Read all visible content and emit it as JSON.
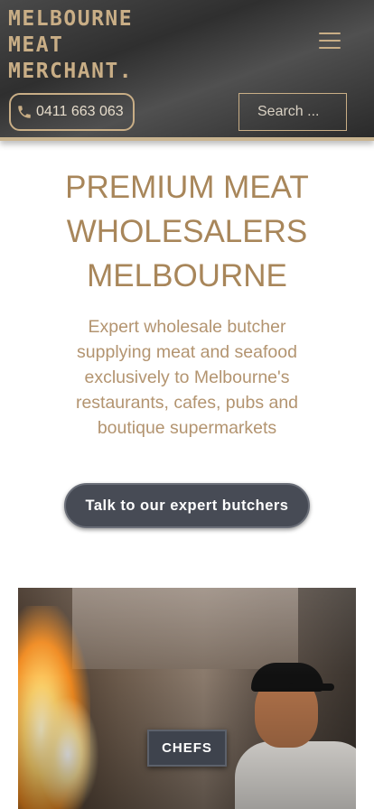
{
  "header": {
    "logo_lines": [
      "MELBOURNE",
      "MEAT",
      "MERCHANT."
    ],
    "phone_label": "0411 663 063",
    "search_placeholder": "Search ...",
    "menu_icon": "hamburger-menu-icon",
    "phone_icon": "phone-icon"
  },
  "hero": {
    "title": "PREMIUM MEAT WHOLESALERS MELBOURNE",
    "subtitle": "Expert wholesale butcher supplying meat and seafood exclusively to Melbourne's restaurants, cafes, pubs and boutique supermarkets",
    "cta_label": "Talk to our expert butchers"
  },
  "cards": [
    {
      "label": "CHEFS"
    }
  ],
  "colors": {
    "accent_gold": "#c9ae86",
    "title_gold": "#a8865a",
    "button_dark": "#474b55"
  }
}
